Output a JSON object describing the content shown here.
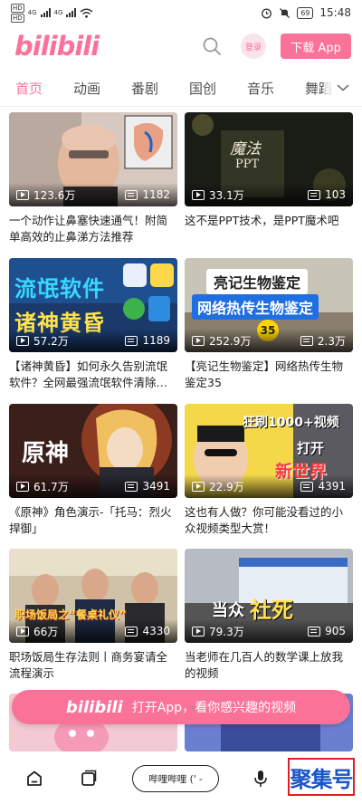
{
  "status_bar": {
    "hd1": "HD",
    "hd2": "HD",
    "net1": "4G",
    "net2": "4G",
    "battery": "69",
    "time": "15:48"
  },
  "header": {
    "logo_text": "bilibili",
    "login_label": "登录",
    "download_label": "下载 App"
  },
  "tabs": [
    {
      "label": "首页",
      "active": true
    },
    {
      "label": "动画",
      "active": false
    },
    {
      "label": "番剧",
      "active": false
    },
    {
      "label": "国创",
      "active": false
    },
    {
      "label": "音乐",
      "active": false
    },
    {
      "label": "舞蹈",
      "active": false
    }
  ],
  "videos": [
    {
      "title": "一个动作让鼻塞快速通气！附简单高效的止鼻涕方法推荐",
      "views": "123.6万",
      "danmaku": "1182"
    },
    {
      "title": "这不是PPT技术，是PPT魔术吧",
      "views": "33.1万",
      "danmaku": "103",
      "thumb_text_1": "魔法",
      "thumb_text_2": "PPT"
    },
    {
      "title": "【诸神黄昏】如何永久告别流氓软件？全网最强流氓软件清除…",
      "views": "57.2万",
      "danmaku": "1189",
      "thumb_text_1": "流氓软件",
      "thumb_text_2": "诸神黄昏"
    },
    {
      "title": "【亮记生物鉴定】网络热传生物鉴定35",
      "views": "252.9万",
      "danmaku": "2.3万",
      "thumb_text_1": "亮记生物鉴定",
      "thumb_text_2": "网络热传生物鉴定",
      "thumb_text_3": "35"
    },
    {
      "title": "《原神》角色演示-「托马：烈火捍御」",
      "views": "61.7万",
      "danmaku": "3491",
      "thumb_text_1": "原神"
    },
    {
      "title": "这也有人做？你可能没看过的小众视频类型大赏！",
      "views": "22.9万",
      "danmaku": "4391",
      "thumb_text_1": "狂刷1000+视频",
      "thumb_text_2": "打开",
      "thumb_text_3": "新世界"
    },
    {
      "title": "职场饭局生存法则丨商务宴请全流程演示",
      "views": "66万",
      "danmaku": "4330",
      "thumb_text_1": "职场饭局之“餐桌礼仪”"
    },
    {
      "title": "当老师在几百人的数学课上放我的视频",
      "views": "79.3万",
      "danmaku": "905",
      "thumb_text_1": "当众",
      "thumb_text_2": "社死"
    }
  ],
  "open_app_banner": {
    "logo_text": "bilibili",
    "label": "打开App，看你感兴趣的视频"
  },
  "bottom_nav": {
    "pill_label": "哔哩哔哩 (' -",
    "watermark_text": "聚集号"
  },
  "colors": {
    "brand_pink": "#fb7299"
  }
}
